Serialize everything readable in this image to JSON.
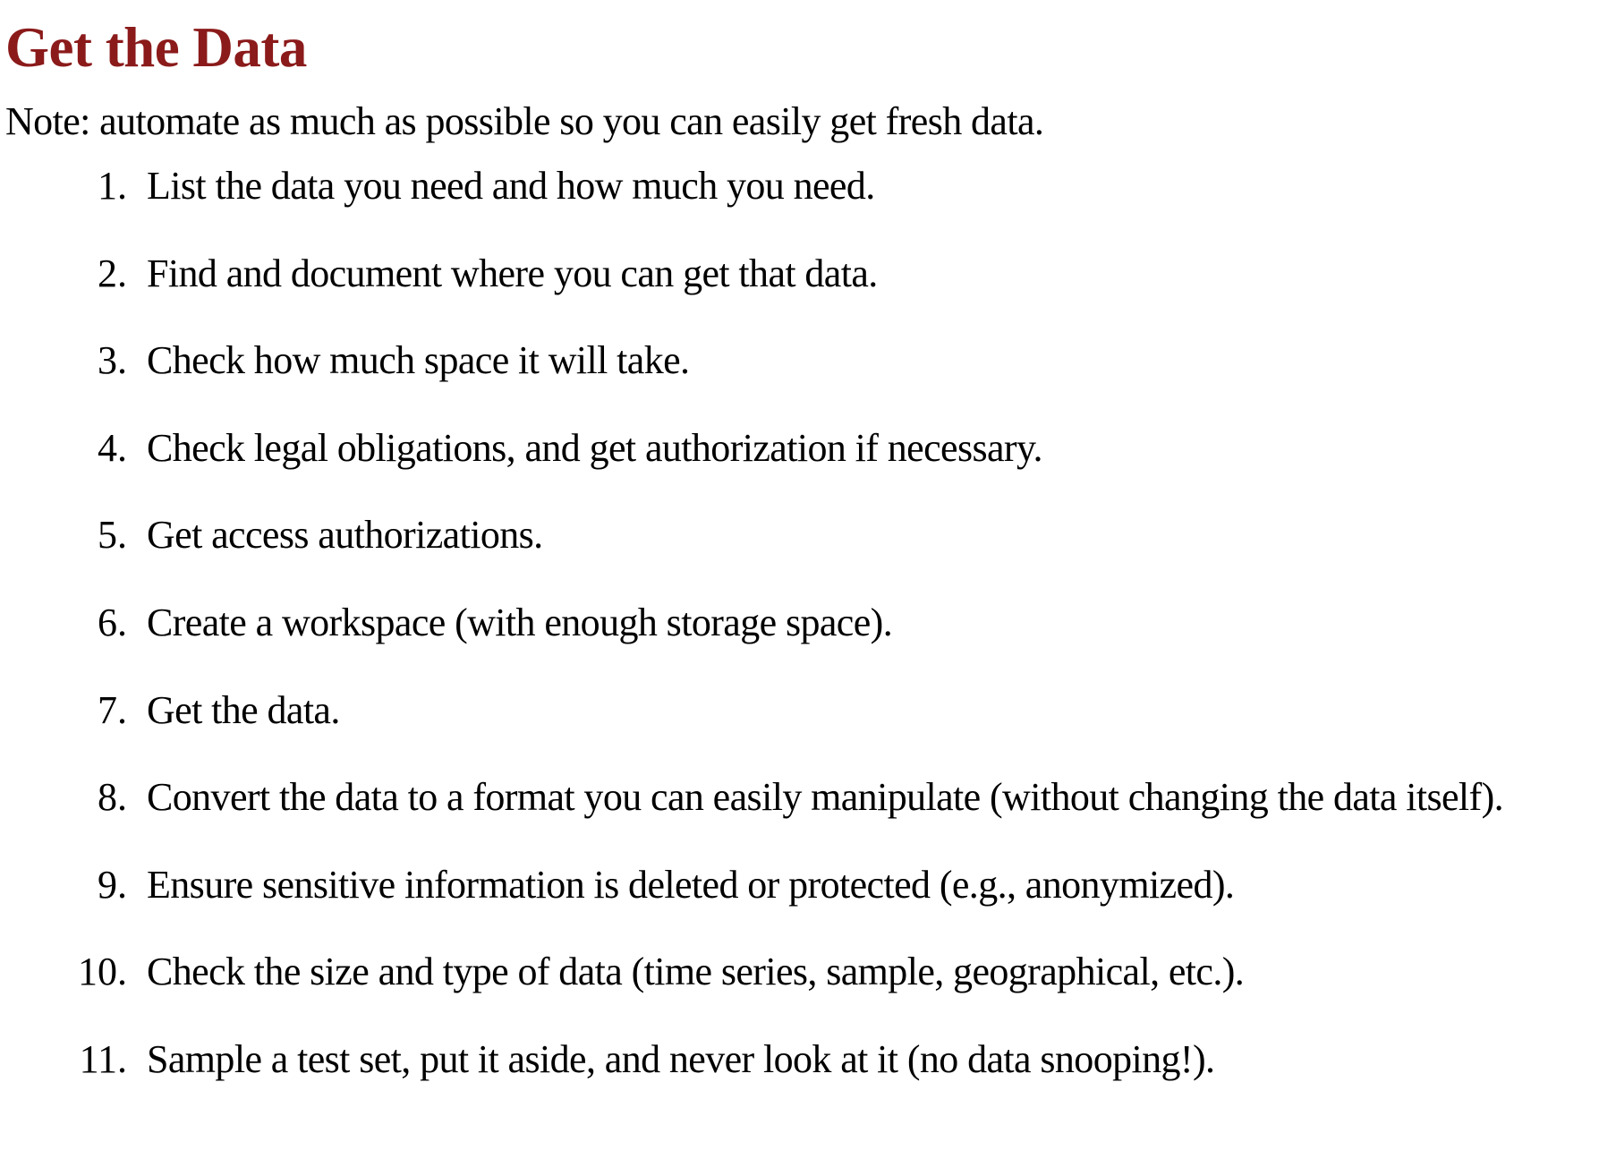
{
  "document": {
    "title": "Get the Data",
    "note": "Note: automate as much as possible so you can easily get fresh data.",
    "steps": [
      {
        "number": "1.",
        "text": "List the data you need and how much you need."
      },
      {
        "number": "2.",
        "text": "Find and document where you can get that data."
      },
      {
        "number": "3.",
        "text": "Check how much space it will take."
      },
      {
        "number": "4.",
        "text": "Check legal obligations, and get authorization if necessary."
      },
      {
        "number": "5.",
        "text": "Get access authorizations."
      },
      {
        "number": "6.",
        "text": "Create a workspace (with enough storage space)."
      },
      {
        "number": "7.",
        "text": "Get the data."
      },
      {
        "number": "8.",
        "text": "Convert the data to a format you can easily manipulate (without changing the data itself)."
      },
      {
        "number": "9.",
        "text": "Ensure sensitive information is deleted or protected (e.g., anonymized)."
      },
      {
        "number": "10.",
        "text": "Check the size and type of data (time series, sample, geographical, etc.)."
      },
      {
        "number": "11.",
        "text": "Sample a test set, put it aside, and never look at it (no data snooping!)."
      }
    ]
  },
  "colors": {
    "title": "#8b1a1a",
    "text": "#000000",
    "background": "#ffffff"
  }
}
